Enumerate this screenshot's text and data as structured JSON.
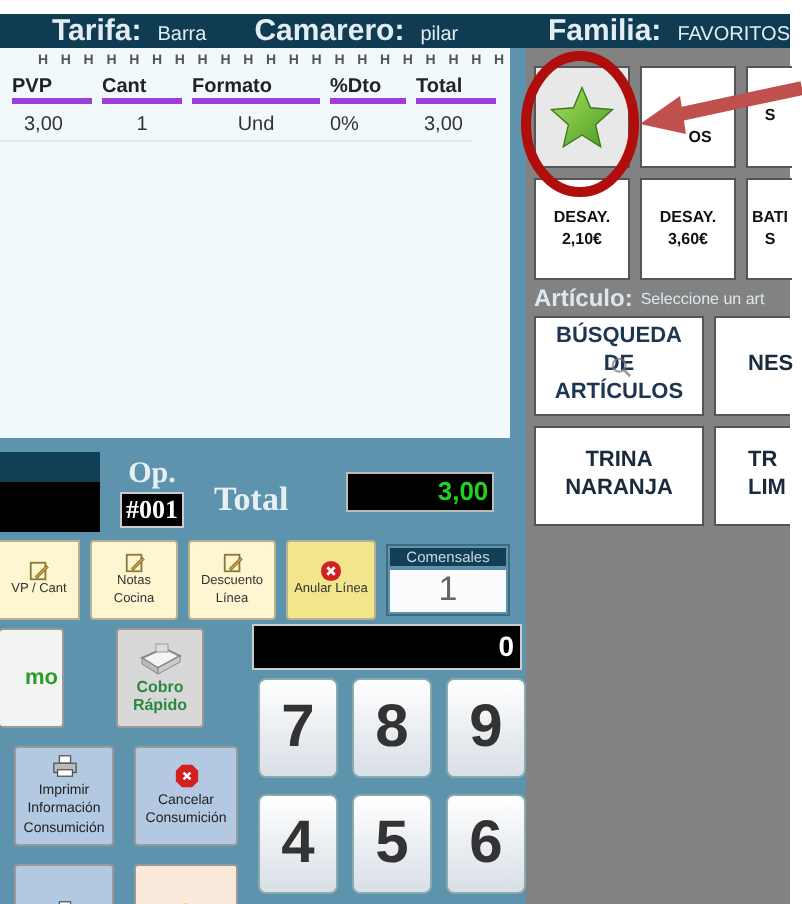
{
  "header": {
    "tarifa_label": "Tarifa:",
    "tarifa": "Barra",
    "camarero_label": "Camarero:",
    "camarero": "pilar",
    "familia_label": "Familia:",
    "familia": "FAVORITOS"
  },
  "ticket": {
    "marks": "H H H H H H H H H H H H H H H H H H H H H",
    "columns": [
      "PVP",
      "Cant",
      "Formato",
      "%Dto",
      "Total"
    ],
    "rows": [
      [
        "3,00",
        "1",
        "Und",
        "0%",
        "3,00"
      ]
    ]
  },
  "op": {
    "label": "Op.",
    "number": "#001"
  },
  "total": {
    "label": "Total",
    "value": "3,00"
  },
  "line_buttons": [
    {
      "kind": "note",
      "label": "VP / Cant"
    },
    {
      "kind": "note",
      "label": "Notas\nCocina"
    },
    {
      "kind": "note",
      "label": "Descuento\nLínea"
    },
    {
      "kind": "cancel",
      "label": "Anular Línea"
    }
  ],
  "comensales": {
    "label": "Comensales",
    "value": "1"
  },
  "display": "0",
  "actions": [
    {
      "kind": "green",
      "label": "mo"
    },
    {
      "kind": "card",
      "label": "Cobro\nRápido"
    },
    {
      "kind": "print",
      "label": "Imprimir\nInformación\nConsumición"
    },
    {
      "kind": "cancel",
      "label": "Cancelar\nConsumición"
    },
    {
      "kind": "print"
    },
    {
      "kind": "cloud"
    }
  ],
  "keypad": [
    "7",
    "8",
    "9",
    "4",
    "5",
    "6"
  ],
  "families": [
    {
      "kind": "star"
    },
    {
      "kind": "text",
      "label": "OS"
    },
    {
      "kind": "text",
      "label": "S"
    },
    {
      "kind": "text",
      "label": "DESAY.\n2,10€"
    },
    {
      "kind": "text",
      "label": "DESAY.\n3,60€"
    },
    {
      "kind": "text",
      "label": "BATI\nS"
    }
  ],
  "articulo": {
    "label": "Artículo:",
    "hint": "Seleccione un art"
  },
  "articles": [
    {
      "kind": "search",
      "label": "BÚSQUEDA\nDE\nARTÍCULOS"
    },
    {
      "kind": "text",
      "label": "NES"
    },
    {
      "kind": "text",
      "label": "TRINA\nNARANJA"
    },
    {
      "kind": "text",
      "label": "TR\nLIM"
    }
  ]
}
